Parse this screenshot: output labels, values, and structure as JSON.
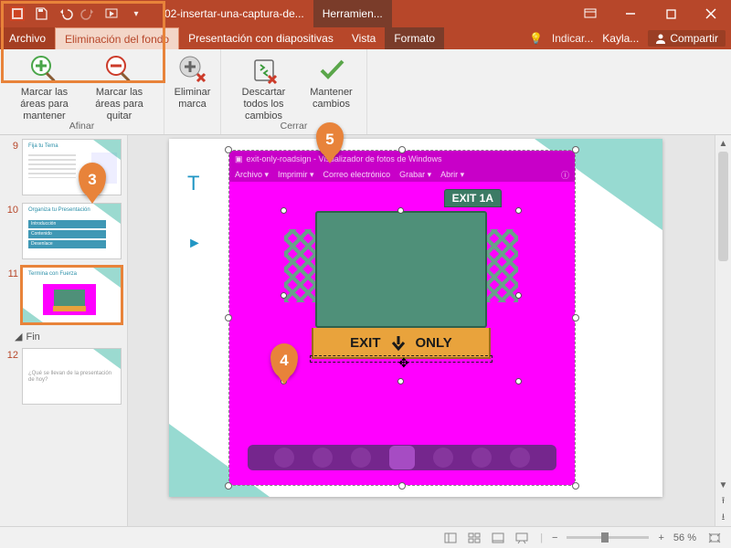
{
  "titlebar": {
    "doc_name": "02-insertar-una-captura-de...",
    "tool_context": "Herramien..."
  },
  "window_controls": {
    "ribbon_opts": "⋯"
  },
  "tabs": {
    "archivo": "Archivo",
    "elim_fondo": "Eliminación del fondo",
    "presentacion": "Presentación con diapositivas",
    "vista": "Vista",
    "formato": "Formato",
    "tell_me": "Indicar...",
    "user": "Kayla...",
    "share": "Compartir"
  },
  "ribbon": {
    "mark_keep": "Marcar las áreas para mantener",
    "mark_remove": "Marcar las áreas para quitar",
    "delete_mark": "Eliminar marca",
    "discard": "Descartar todos los cambios",
    "keep": "Mantener cambios",
    "group_refine": "Afinar",
    "group_close": "Cerrar"
  },
  "thumbs": {
    "n9": "9",
    "n10": "10",
    "n11": "11",
    "n12": "12",
    "section": "Fin",
    "s9_title": "Fija tu Tema",
    "s10_title": "Organiza tu Presentación",
    "s11_title": "Termina con Fuerza",
    "s12_text": "¿Qué se llevan de la presentación de hoy?",
    "s10_i1": "Introducción",
    "s10_i2": "Contenido",
    "s10_i3": "Desenlace"
  },
  "slide": {
    "title_initial": "T",
    "bullet_marker": "►"
  },
  "photo_viewer": {
    "title": "exit-only-roadsign - Visualizador de fotos de Windows",
    "m1": "Archivo ▾",
    "m2": "Imprimir ▾",
    "m3": "Correo electrónico",
    "m4": "Grabar ▾",
    "m5": "Abrir ▾"
  },
  "sign": {
    "top": "EXIT 1A",
    "exit": "EXIT",
    "only": "ONLY"
  },
  "status": {
    "zoom": "56 %"
  },
  "callouts": {
    "c3": "3",
    "c4": "4",
    "c5": "5"
  }
}
